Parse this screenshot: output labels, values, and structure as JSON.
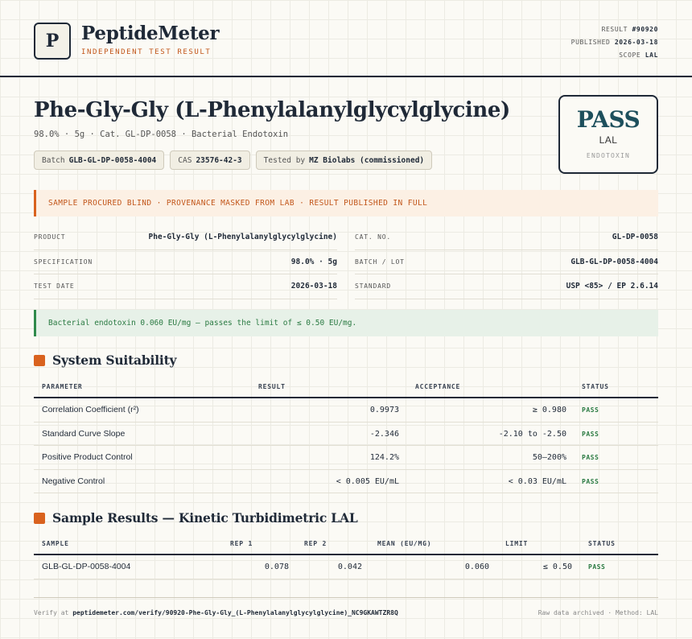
{
  "header": {
    "logo_letter": "P",
    "brand": "PeptideMeter",
    "tagline": "INDEPENDENT TEST RESULT",
    "meta": {
      "result_label": "RESULT",
      "result_value": "#90920",
      "published_label": "PUBLISHED",
      "published_value": "2026-03-18",
      "scope_label": "SCOPE",
      "scope_value": "LAL"
    }
  },
  "product": {
    "title": "Phe-Gly-Gly (L-Phenylalanylglycylglycine)",
    "subtitle": "98.0% · 5g · Cat. GL-DP-0058 · Bacterial Endotoxin",
    "chips": [
      {
        "label": "Batch",
        "value": "GLB-GL-DP-0058-4004"
      },
      {
        "label": "CAS",
        "value": "23576-42-3"
      },
      {
        "label": "Tested by",
        "value": "MZ Biolabs (commissioned)"
      }
    ]
  },
  "verdict": {
    "word": "PASS",
    "method": "LAL",
    "category": "ENDOTOXIN"
  },
  "notices": {
    "blind": "SAMPLE PROCURED BLIND · PROVENANCE MASKED FROM LAB · RESULT PUBLISHED IN FULL",
    "summary": "Bacterial endotoxin 0.060 EU/mg — passes the limit of ≤ 0.50 EU/mg."
  },
  "info": {
    "left": [
      {
        "label": "PRODUCT",
        "value": "Phe-Gly-Gly (L-Phenylalanylglycylglycine)"
      },
      {
        "label": "SPECIFICATION",
        "value": "98.0% · 5g"
      },
      {
        "label": "TEST DATE",
        "value": "2026-03-18"
      }
    ],
    "right": [
      {
        "label": "CAT. NO.",
        "value": "GL-DP-0058"
      },
      {
        "label": "BATCH / LOT",
        "value": "GLB-GL-DP-0058-4004"
      },
      {
        "label": "STANDARD",
        "value": "USP <85> / EP 2.6.14"
      }
    ]
  },
  "suitability": {
    "title": "System Suitability",
    "headers": [
      "PARAMETER",
      "RESULT",
      "ACCEPTANCE",
      "STATUS"
    ],
    "rows": [
      {
        "parameter": "Correlation Coefficient (r²)",
        "result": "0.9973",
        "acceptance": "≥ 0.980",
        "status": "PASS"
      },
      {
        "parameter": "Standard Curve Slope",
        "result": "-2.346",
        "acceptance": "-2.10 to -2.50",
        "status": "PASS"
      },
      {
        "parameter": "Positive Product Control",
        "result": "124.2%",
        "acceptance": "50–200%",
        "status": "PASS"
      },
      {
        "parameter": "Negative Control",
        "result": "< 0.005 EU/mL",
        "acceptance": "< 0.03 EU/mL",
        "status": "PASS"
      }
    ]
  },
  "samples": {
    "title": "Sample Results — Kinetic Turbidimetric LAL",
    "headers": [
      "SAMPLE",
      "REP 1",
      "REP 2",
      "MEAN (EU/MG)",
      "LIMIT",
      "STATUS"
    ],
    "rows": [
      {
        "sample": "GLB-GL-DP-0058-4004",
        "rep1": "0.078",
        "rep2": "0.042",
        "mean": "0.060",
        "limit": "≤ 0.50",
        "status": "PASS"
      }
    ]
  },
  "footer": {
    "verify_prefix": "Verify at",
    "verify_url": "peptidemeter.com/verify/90920-Phe-Gly-Gly_(L-Phenylalanylglycylglycine)_NC9GKAWTZR8Q",
    "archive_note": "Raw data archived · Method: LAL"
  }
}
